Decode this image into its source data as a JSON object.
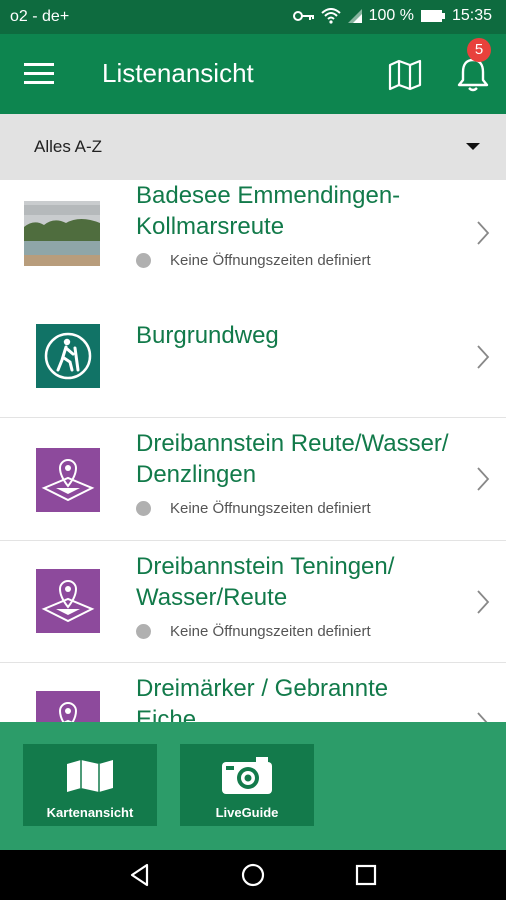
{
  "status_bar": {
    "carrier": "o2 - de+",
    "battery": "100 %",
    "time": "15:35"
  },
  "app_bar": {
    "title": "Listenansicht",
    "notification_count": "5"
  },
  "filter": {
    "selected": "Alles A-Z"
  },
  "list": {
    "items": [
      {
        "name_line1": "Badesee Emmendingen-",
        "name_line2": "Kollmarsreute",
        "status": "Keine Öffnungszeiten definiert",
        "icon": "lake-photo"
      },
      {
        "name_line1": "Burgrundweg",
        "icon": "hiking-icon"
      },
      {
        "name_line1": "Dreibannstein Reute/Wasser/",
        "name_line2": "Denzlingen",
        "status": "Keine Öffnungszeiten definiert",
        "icon": "map-pin-icon"
      },
      {
        "name_line1": "Dreibannstein Teningen/",
        "name_line2": "Wasser/Reute",
        "status": "Keine Öffnungszeiten definiert",
        "icon": "map-pin-icon"
      },
      {
        "name_line1": "Dreimärker / Gebrannte",
        "name_line2": "Eiche",
        "icon": "map-pin-icon"
      }
    ]
  },
  "bottom_bar": {
    "map_label": "Kartenansicht",
    "liveguide_label": "LiveGuide"
  },
  "colors": {
    "appbar": "#0d854f",
    "statusbar": "#0e6b3f",
    "accent_text": "#127a4a",
    "purple": "#8d4a9c",
    "teal": "#117366",
    "bottom": "#2c9c69"
  }
}
